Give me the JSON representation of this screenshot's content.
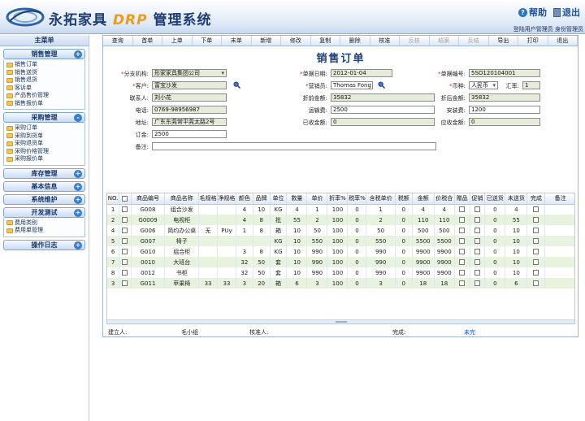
{
  "header": {
    "brand_text": "永拓家具",
    "brand_drp": "DRP",
    "brand_suffix": "管理系统",
    "help_label": "帮助",
    "exit_label": "退出",
    "user_info": "登陆用户管理员 身份管理员"
  },
  "sidebar": {
    "title": "主菜单",
    "groups": [
      {
        "label": "销售管理",
        "toggle": "+",
        "items": [
          "销售订单",
          "销售送货",
          "销售退货",
          "客诉单",
          "产品售价管理",
          "销售报价单"
        ]
      },
      {
        "label": "采购管理",
        "toggle": "-",
        "items": [
          "采购订单",
          "采购到货单",
          "采购退货单",
          "采购价格管理",
          "采购报价单"
        ]
      },
      {
        "label": "库存管理",
        "toggle": "+"
      },
      {
        "label": "基本信息",
        "toggle": "+"
      },
      {
        "label": "系统维护",
        "toggle": "+"
      },
      {
        "label": "开发测试",
        "toggle": "+",
        "items": [
          "费用类别",
          "费用单管理"
        ]
      },
      {
        "label": "操作日志",
        "toggle": "+"
      }
    ]
  },
  "toolbar": {
    "buttons": [
      {
        "label": "查询",
        "enabled": true
      },
      {
        "label": "首单",
        "enabled": true
      },
      {
        "label": "上单",
        "enabled": true
      },
      {
        "label": "下单",
        "enabled": true
      },
      {
        "label": "末单",
        "enabled": true
      },
      {
        "label": "新增",
        "enabled": true
      },
      {
        "label": "修改",
        "enabled": true
      },
      {
        "label": "复制",
        "enabled": true
      },
      {
        "label": "删除",
        "enabled": true
      },
      {
        "label": "核准",
        "enabled": true
      },
      {
        "label": "反核",
        "enabled": false
      },
      {
        "label": "结案",
        "enabled": false
      },
      {
        "label": "反结",
        "enabled": false
      },
      {
        "label": "导出",
        "enabled": true
      },
      {
        "label": "打印",
        "enabled": true
      },
      {
        "label": "退出",
        "enabled": true
      }
    ]
  },
  "form": {
    "title": "销售订单",
    "branch_label": "分支机构:",
    "branch_value": "形家家具集团公司",
    "order_date_label": "单据日期:",
    "order_date_value": "2012-01-04",
    "order_no_label": "单据编号:",
    "order_no_value": "5SO120104001",
    "customer_label": "客户:",
    "customer_value": "富宝沙发",
    "salesman_label": "营销员:",
    "salesman_value": "Thomas Fong",
    "currency_label": "币种:",
    "currency_value": "人民币",
    "rate_label": "汇率:",
    "rate_value": "1",
    "contact_label": "联系人:",
    "contact_value": "刘小花",
    "pre_discount_label": "折前金额:",
    "pre_discount_value": "35832",
    "post_discount_label": "折后金额:",
    "post_discount_value": "35832",
    "phone_label": "电话:",
    "phone_value": "0769-98956987",
    "freight_label": "运输费:",
    "freight_value": "2500",
    "install_label": "安装费:",
    "install_value": "1200",
    "address_label": "地址:",
    "address_value": "广东东莞常平莞太路2号",
    "received_label": "已收金额:",
    "received_value": "0",
    "receivable_label": "应收金额:",
    "receivable_value": "0",
    "deposit_label": "订金:",
    "deposit_value": "2500",
    "remark_label": "备注:",
    "remark_value": ""
  },
  "grid": {
    "columns": [
      "NO.",
      "",
      "商品编号",
      "商品名称",
      "毛规格",
      "净规格",
      "颜色",
      "品牌",
      "单位",
      "数量",
      "单价",
      "折率%",
      "税率%",
      "含税单价",
      "税额",
      "金额",
      "价税合",
      "赠品",
      "促销",
      "已送货",
      "未送货",
      "完成",
      "备注"
    ],
    "rows": [
      [
        "1",
        "",
        "G008",
        "组合沙发",
        "",
        "",
        "4",
        "10",
        "KG",
        "4",
        "1",
        "100",
        "0",
        "1",
        "0",
        "4",
        "4",
        "",
        "",
        "0",
        "4",
        "",
        ""
      ],
      [
        "2",
        "",
        "G0009",
        "电视柜",
        "",
        "",
        "4",
        "8",
        "批",
        "55",
        "2",
        "100",
        "0",
        "2",
        "0",
        "110",
        "110",
        "",
        "",
        "0",
        "55",
        "",
        ""
      ],
      [
        "4",
        "",
        "G006",
        "简约办公桌",
        "无",
        "PUy",
        "1",
        "8",
        "箱",
        "10",
        "50",
        "100",
        "0",
        "50",
        "0",
        "500",
        "500",
        "",
        "",
        "0",
        "10",
        "",
        ""
      ],
      [
        "5",
        "",
        "G007",
        "椅子",
        "",
        "",
        "",
        "",
        "KG",
        "10",
        "550",
        "100",
        "0",
        "550",
        "0",
        "5500",
        "5500",
        "",
        "",
        "0",
        "10",
        "",
        ""
      ],
      [
        "6",
        "",
        "G010",
        "组合柜",
        "",
        "",
        "3",
        "8",
        "KG",
        "10",
        "990",
        "100",
        "0",
        "990",
        "0",
        "9900",
        "9900",
        "",
        "",
        "0",
        "10",
        "",
        ""
      ],
      [
        "7",
        "",
        "0010",
        "大班台",
        "",
        "",
        "32",
        "50",
        "套",
        "10",
        "990",
        "100",
        "0",
        "990",
        "0",
        "9900",
        "9900",
        "",
        "",
        "0",
        "10",
        "",
        ""
      ],
      [
        "8",
        "",
        "0012",
        "书柜",
        "",
        "",
        "32",
        "50",
        "套",
        "10",
        "990",
        "100",
        "0",
        "990",
        "0",
        "9900",
        "9900",
        "",
        "",
        "0",
        "10",
        "",
        ""
      ],
      [
        "3",
        "",
        "G011",
        "苹果椅",
        "33",
        "33",
        "3",
        "20",
        "箱",
        "6",
        "3",
        "100",
        "0",
        "3",
        "0",
        "18",
        "18",
        "",
        "",
        "0",
        "6",
        "",
        ""
      ]
    ]
  },
  "footer": {
    "creator_label": "建立人:",
    "creator_value": "毛小组",
    "approver_label": "核准人:",
    "approver_value": "",
    "complete_label": "完成:",
    "complete_value": "未完"
  },
  "colors": {
    "header_title": "#1d3d74",
    "drp_accent": "#f39a19",
    "required": "#d31c1c",
    "row_highlight": "#e8f3df",
    "status_link": "#1a4fd0"
  }
}
